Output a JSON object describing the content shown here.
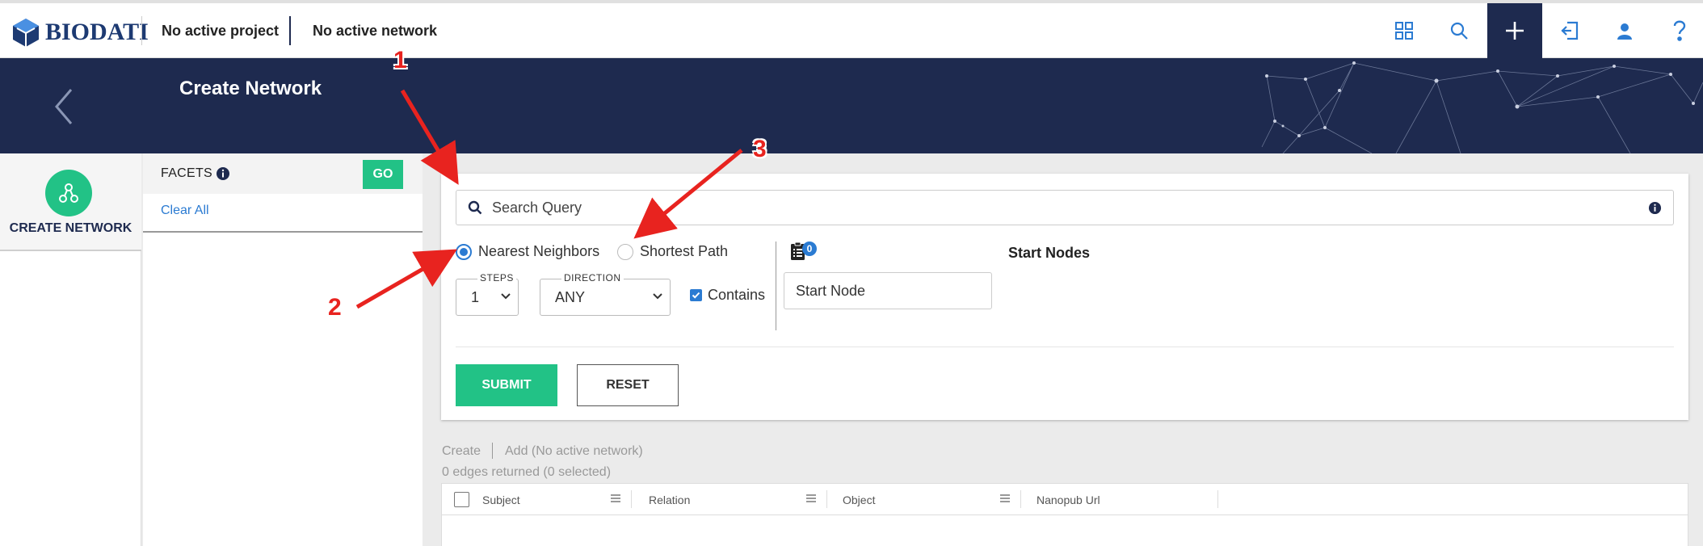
{
  "app": {
    "logo_text": "BIODATI",
    "project": "No active project",
    "network": "No active network"
  },
  "topbar_icons": [
    "grid-icon",
    "search-icon",
    "plus-icon",
    "sign-in-icon",
    "user-icon",
    "help-icon"
  ],
  "banner": {
    "title": "Create Network"
  },
  "sidebar": {
    "item_label": "CREATE NETWORK"
  },
  "facets": {
    "title": "FACETS",
    "go_label": "GO",
    "clear_all": "Clear All"
  },
  "search": {
    "placeholder": "Search Query"
  },
  "mode": {
    "options": [
      "Nearest Neighbors",
      "Shortest Path"
    ],
    "selected": "Nearest Neighbors"
  },
  "steps": {
    "label": "STEPS",
    "value": "1"
  },
  "direction": {
    "label": "DIRECTION",
    "value": "ANY"
  },
  "contains": {
    "label": "Contains",
    "checked": true
  },
  "start_nodes": {
    "badge": "0",
    "placeholder": "Start Node",
    "title": "Start Nodes"
  },
  "buttons": {
    "submit": "SUBMIT",
    "reset": "RESET"
  },
  "results": {
    "create_link": "Create",
    "add_link": "Add (No active network)",
    "summary": "0 edges returned (0 selected)",
    "columns": [
      "Subject",
      "Relation",
      "Object",
      "Nanopub Url"
    ]
  },
  "annotations": [
    "1",
    "2",
    "3"
  ],
  "colors": {
    "navy": "#1e2a4f",
    "green": "#22c286",
    "blue": "#2b7bd2",
    "annotation_red": "#e8231f"
  }
}
